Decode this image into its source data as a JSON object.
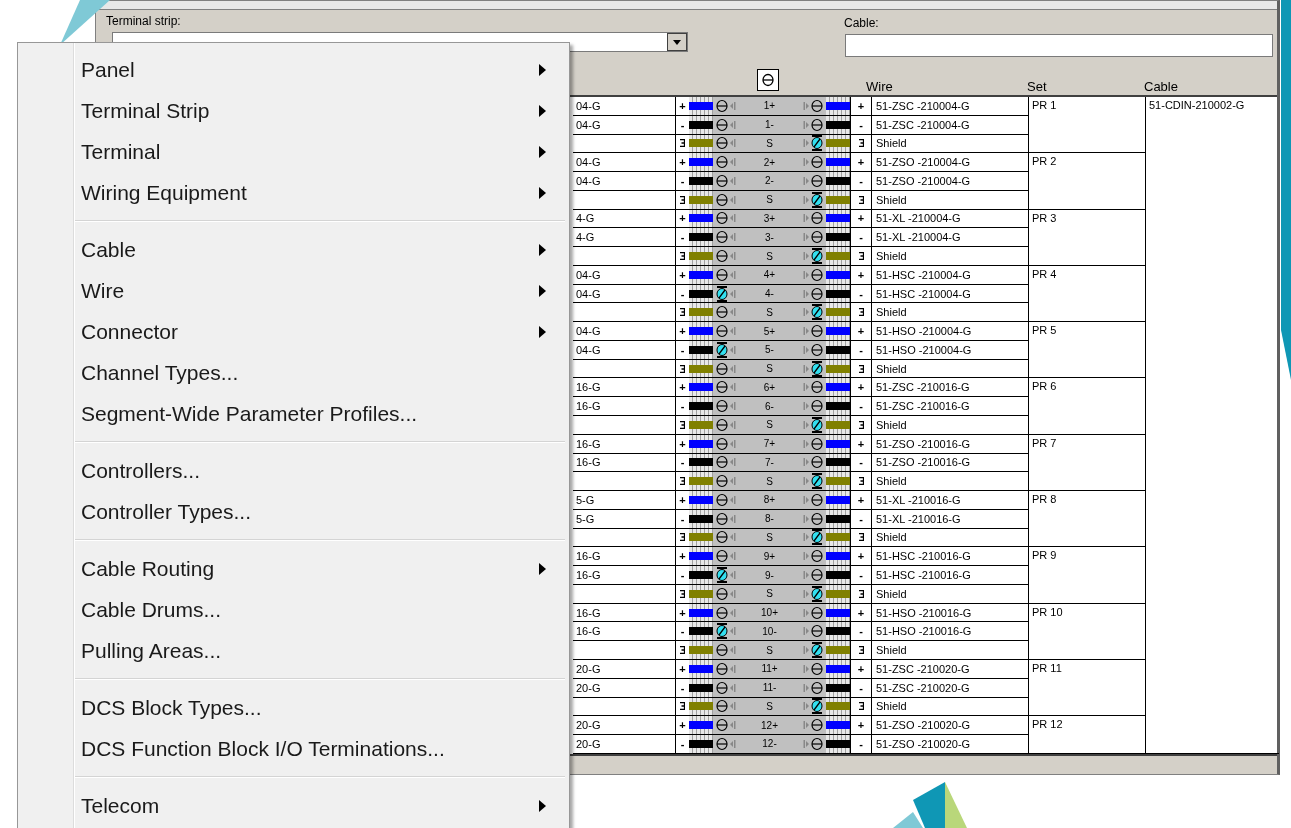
{
  "form": {
    "terminal_strip_label": "Terminal strip:",
    "cable_label": "Cable:"
  },
  "table": {
    "columns": [
      "Wire",
      "Set",
      "Cable"
    ],
    "cable": "51-CDIN-210002-G",
    "pairs": [
      {
        "set": "PR 1",
        "rows": [
          {
            "kind": "conductor",
            "end": "04-G",
            "sign": "+",
            "color": "#0000ff",
            "terminal": "1+",
            "left_marked": false,
            "right_marked": false,
            "wire": "51-ZSC -210004-G"
          },
          {
            "kind": "conductor",
            "end": "04-G",
            "sign": "-",
            "color": "#000000",
            "terminal": "1-",
            "left_marked": false,
            "right_marked": false,
            "wire": "51-ZSC -210004-G"
          },
          {
            "kind": "shield",
            "color": "#808000",
            "terminal": "S",
            "left_marked": false,
            "right_marked": true,
            "wire": "Shield"
          }
        ]
      },
      {
        "set": "PR 2",
        "rows": [
          {
            "kind": "conductor",
            "end": "04-G",
            "sign": "+",
            "color": "#0000ff",
            "terminal": "2+",
            "left_marked": false,
            "right_marked": false,
            "wire": "51-ZSO -210004-G"
          },
          {
            "kind": "conductor",
            "end": "04-G",
            "sign": "-",
            "color": "#000000",
            "terminal": "2-",
            "left_marked": false,
            "right_marked": false,
            "wire": "51-ZSO -210004-G"
          },
          {
            "kind": "shield",
            "color": "#808000",
            "terminal": "S",
            "left_marked": false,
            "right_marked": true,
            "wire": "Shield"
          }
        ]
      },
      {
        "set": "PR 3",
        "rows": [
          {
            "kind": "conductor",
            "end": "4-G",
            "sign": "+",
            "color": "#0000ff",
            "terminal": "3+",
            "left_marked": false,
            "right_marked": false,
            "wire": "51-XL -210004-G"
          },
          {
            "kind": "conductor",
            "end": "4-G",
            "sign": "-",
            "color": "#000000",
            "terminal": "3-",
            "left_marked": false,
            "right_marked": false,
            "wire": "51-XL -210004-G"
          },
          {
            "kind": "shield",
            "color": "#808000",
            "terminal": "S",
            "left_marked": false,
            "right_marked": true,
            "wire": "Shield"
          }
        ]
      },
      {
        "set": "PR 4",
        "rows": [
          {
            "kind": "conductor",
            "end": "04-G",
            "sign": "+",
            "color": "#0000ff",
            "terminal": "4+",
            "left_marked": false,
            "right_marked": false,
            "wire": "51-HSC -210004-G"
          },
          {
            "kind": "conductor",
            "end": "04-G",
            "sign": "-",
            "color": "#000000",
            "terminal": "4-",
            "left_marked": true,
            "right_marked": false,
            "wire": "51-HSC -210004-G"
          },
          {
            "kind": "shield",
            "color": "#808000",
            "terminal": "S",
            "left_marked": false,
            "right_marked": true,
            "wire": "Shield"
          }
        ]
      },
      {
        "set": "PR 5",
        "rows": [
          {
            "kind": "conductor",
            "end": "04-G",
            "sign": "+",
            "color": "#0000ff",
            "terminal": "5+",
            "left_marked": false,
            "right_marked": false,
            "wire": "51-HSO -210004-G"
          },
          {
            "kind": "conductor",
            "end": "04-G",
            "sign": "-",
            "color": "#000000",
            "terminal": "5-",
            "left_marked": true,
            "right_marked": false,
            "wire": "51-HSO -210004-G"
          },
          {
            "kind": "shield",
            "color": "#808000",
            "terminal": "S",
            "left_marked": false,
            "right_marked": true,
            "wire": "Shield"
          }
        ]
      },
      {
        "set": "PR 6",
        "rows": [
          {
            "kind": "conductor",
            "end": "16-G",
            "sign": "+",
            "color": "#0000ff",
            "terminal": "6+",
            "left_marked": false,
            "right_marked": false,
            "wire": "51-ZSC -210016-G"
          },
          {
            "kind": "conductor",
            "end": "16-G",
            "sign": "-",
            "color": "#000000",
            "terminal": "6-",
            "left_marked": false,
            "right_marked": false,
            "wire": "51-ZSC -210016-G"
          },
          {
            "kind": "shield",
            "color": "#808000",
            "terminal": "S",
            "left_marked": false,
            "right_marked": true,
            "wire": "Shield"
          }
        ]
      },
      {
        "set": "PR 7",
        "rows": [
          {
            "kind": "conductor",
            "end": "16-G",
            "sign": "+",
            "color": "#0000ff",
            "terminal": "7+",
            "left_marked": false,
            "right_marked": false,
            "wire": "51-ZSO -210016-G"
          },
          {
            "kind": "conductor",
            "end": "16-G",
            "sign": "-",
            "color": "#000000",
            "terminal": "7-",
            "left_marked": false,
            "right_marked": false,
            "wire": "51-ZSO -210016-G"
          },
          {
            "kind": "shield",
            "color": "#808000",
            "terminal": "S",
            "left_marked": false,
            "right_marked": true,
            "wire": "Shield"
          }
        ]
      },
      {
        "set": "PR 8",
        "rows": [
          {
            "kind": "conductor",
            "end": "5-G",
            "sign": "+",
            "color": "#0000ff",
            "terminal": "8+",
            "left_marked": false,
            "right_marked": false,
            "wire": "51-XL -210016-G"
          },
          {
            "kind": "conductor",
            "end": "5-G",
            "sign": "-",
            "color": "#000000",
            "terminal": "8-",
            "left_marked": false,
            "right_marked": false,
            "wire": "51-XL -210016-G"
          },
          {
            "kind": "shield",
            "color": "#808000",
            "terminal": "S",
            "left_marked": false,
            "right_marked": true,
            "wire": "Shield"
          }
        ]
      },
      {
        "set": "PR 9",
        "rows": [
          {
            "kind": "conductor",
            "end": "16-G",
            "sign": "+",
            "color": "#0000ff",
            "terminal": "9+",
            "left_marked": false,
            "right_marked": false,
            "wire": "51-HSC -210016-G"
          },
          {
            "kind": "conductor",
            "end": "16-G",
            "sign": "-",
            "color": "#000000",
            "terminal": "9-",
            "left_marked": true,
            "right_marked": false,
            "wire": "51-HSC -210016-G"
          },
          {
            "kind": "shield",
            "color": "#808000",
            "terminal": "S",
            "left_marked": false,
            "right_marked": true,
            "wire": "Shield"
          }
        ]
      },
      {
        "set": "PR 10",
        "rows": [
          {
            "kind": "conductor",
            "end": "16-G",
            "sign": "+",
            "color": "#0000ff",
            "terminal": "10+",
            "left_marked": false,
            "right_marked": false,
            "wire": "51-HSO -210016-G"
          },
          {
            "kind": "conductor",
            "end": "16-G",
            "sign": "-",
            "color": "#000000",
            "terminal": "10-",
            "left_marked": true,
            "right_marked": false,
            "wire": "51-HSO -210016-G"
          },
          {
            "kind": "shield",
            "color": "#808000",
            "terminal": "S",
            "left_marked": false,
            "right_marked": true,
            "wire": "Shield"
          }
        ]
      },
      {
        "set": "PR 11",
        "rows": [
          {
            "kind": "conductor",
            "end": "20-G",
            "sign": "+",
            "color": "#0000ff",
            "terminal": "11+",
            "left_marked": false,
            "right_marked": false,
            "wire": "51-ZSC -210020-G"
          },
          {
            "kind": "conductor",
            "end": "20-G",
            "sign": "-",
            "color": "#000000",
            "terminal": "11-",
            "left_marked": false,
            "right_marked": false,
            "wire": "51-ZSC -210020-G"
          },
          {
            "kind": "shield",
            "color": "#808000",
            "terminal": "S",
            "left_marked": false,
            "right_marked": true,
            "wire": "Shield"
          }
        ]
      },
      {
        "set": "PR 12",
        "rows": [
          {
            "kind": "conductor",
            "end": "20-G",
            "sign": "+",
            "color": "#0000ff",
            "terminal": "12+",
            "left_marked": false,
            "right_marked": false,
            "wire": "51-ZSO -210020-G"
          },
          {
            "kind": "conductor",
            "end": "20-G",
            "sign": "-",
            "color": "#000000",
            "terminal": "12-",
            "left_marked": false,
            "right_marked": false,
            "wire": "51-ZSO -210020-G"
          }
        ]
      }
    ]
  },
  "menu": {
    "groups": [
      {
        "items": [
          {
            "label": "Panel",
            "submenu": true
          },
          {
            "label": "Terminal Strip",
            "submenu": true
          },
          {
            "label": "Terminal",
            "submenu": true
          },
          {
            "label": "Wiring Equipment",
            "submenu": true
          }
        ]
      },
      {
        "items": [
          {
            "label": "Cable",
            "submenu": true
          },
          {
            "label": "Wire",
            "submenu": true
          },
          {
            "label": "Connector",
            "submenu": true
          },
          {
            "label": "Channel Types...",
            "submenu": false
          },
          {
            "label": "Segment-Wide Parameter Profiles...",
            "submenu": false
          }
        ]
      },
      {
        "items": [
          {
            "label": "Controllers...",
            "submenu": false
          },
          {
            "label": "Controller Types...",
            "submenu": false
          }
        ]
      },
      {
        "items": [
          {
            "label": "Cable Routing",
            "submenu": true
          },
          {
            "label": "Cable Drums...",
            "submenu": false
          },
          {
            "label": "Pulling Areas...",
            "submenu": false
          }
        ]
      },
      {
        "items": [
          {
            "label": "DCS Block Types...",
            "submenu": false
          },
          {
            "label": "DCS Function Block I/O Terminations...",
            "submenu": false
          }
        ]
      },
      {
        "items": [
          {
            "label": "Telecom",
            "submenu": true
          }
        ]
      }
    ]
  }
}
